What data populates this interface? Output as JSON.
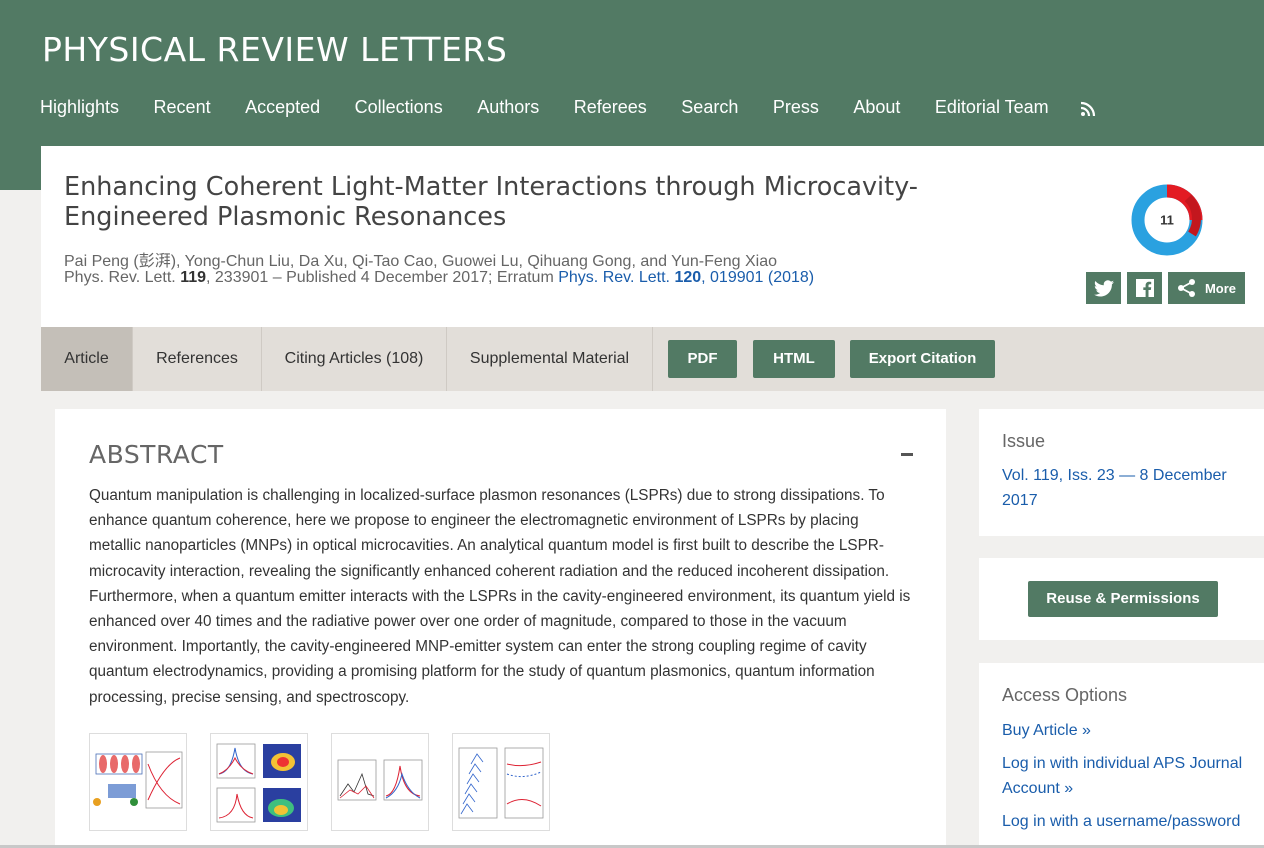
{
  "header": {
    "site_title": "PHYSICAL REVIEW LETTERS",
    "nav": [
      "Highlights",
      "Recent",
      "Accepted",
      "Collections",
      "Authors",
      "Referees",
      "Search",
      "Press",
      "About",
      "Editorial Team"
    ]
  },
  "article": {
    "title": "Enhancing Coherent Light-Matter Interactions through Microcavity-Engineered Plasmonic Resonances",
    "authors": "Pai Peng (彭湃), Yong-Chun Liu, Da Xu, Qi-Tao Cao, Guowei Lu, Qihuang Gong, and Yun-Feng Xiao",
    "citation": {
      "journal": "Phys. Rev. Lett.",
      "volume": "119",
      "article_no": ", 233901 – Published 4 December 2017; Erratum ",
      "erratum_journal": "Phys. Rev. Lett.",
      "erratum_volume": "120",
      "erratum_rest": ", 019901 (2018)"
    },
    "altmetric_score": "11",
    "share": {
      "more_label": "More"
    }
  },
  "tabs": {
    "article": "Article",
    "references": "References",
    "citing": "Citing Articles (108)",
    "supplemental": "Supplemental Material",
    "pdf": "PDF",
    "html": "HTML",
    "export": "Export Citation"
  },
  "abstract": {
    "heading": "ABSTRACT",
    "text": "Quantum manipulation is challenging in localized-surface plasmon resonances (LSPRs) due to strong dissipations. To enhance quantum coherence, here we propose to engineer the electromagnetic environment of LSPRs by placing metallic nanoparticles (MNPs) in optical microcavities. An analytical quantum model is first built to describe the LSPR-microcavity interaction, revealing the significantly enhanced coherent radiation and the reduced incoherent dissipation. Furthermore, when a quantum emitter interacts with the LSPRs in the cavity-engineered environment, its quantum yield is enhanced over 40 times and the radiative power over one order of magnitude, compared to those in the vacuum environment. Importantly, the cavity-engineered MNP-emitter system can enter the strong coupling regime of cavity quantum electrodynamics, providing a promising platform for the study of quantum plasmonics, quantum information processing, precise sensing, and spectroscopy."
  },
  "sidebar": {
    "issue_heading": "Issue",
    "issue_link": "Vol. 119, Iss. 23 — 8 December 2017",
    "reuse_button": "Reuse & Permissions",
    "access_heading": "Access Options",
    "access_links": [
      "Buy Article »",
      "Log in with individual APS Journal Account »",
      "Log in with a username/password"
    ]
  },
  "colors": {
    "brand_green": "#527a64",
    "link_blue": "#1a5dab",
    "altmetric_red": "#e31b23",
    "altmetric_blue": "#2aa1e0"
  }
}
